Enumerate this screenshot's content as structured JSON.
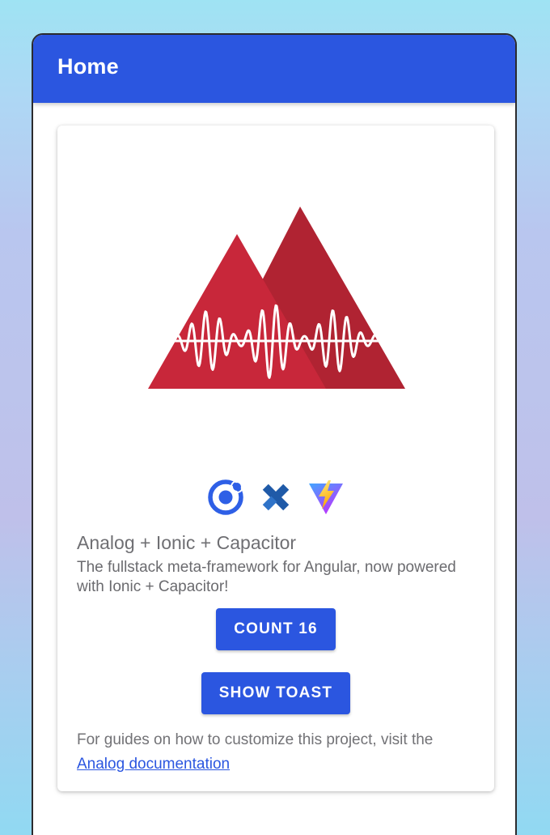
{
  "header": {
    "title": "Home"
  },
  "card": {
    "logo": "analog-mountain-logo",
    "tech_icons": [
      "ionic-icon",
      "capacitor-icon",
      "vite-icon"
    ],
    "title": "Analog + Ionic + Capacitor",
    "subtitle": "The fullstack meta-framework for Angular, now powered with Ionic + Capacitor!",
    "count_button_label": "COUNT 16",
    "count_value": 16,
    "toast_button_label": "SHOW TOAST",
    "footnote_text": "For guides on how to customize this project, visit the",
    "footnote_link": "Analog documentation"
  },
  "colors": {
    "primary": "#2b56e0",
    "mountain_front": "#c8273a",
    "mountain_back": "#b02332",
    "text_muted": "#6f6f73"
  }
}
